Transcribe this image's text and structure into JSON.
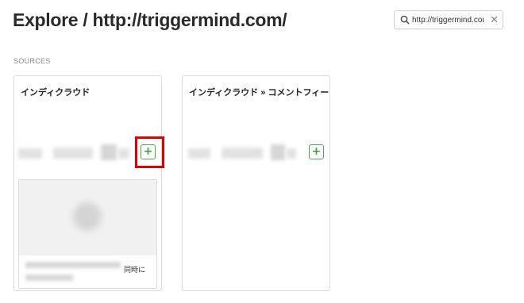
{
  "header": {
    "title": "Explore / http://triggermind.com/",
    "search": {
      "value": "http://triggermind.com/",
      "icon": "search-icon",
      "clear_symbol": "✕"
    }
  },
  "sources": {
    "label": "SOURCES",
    "cards": [
      {
        "title": "インディクラウド",
        "add_symbol": "+",
        "highlighted": true,
        "preview_caption": "同時に"
      },
      {
        "title": "インディクラウド » コメントフィー…",
        "add_symbol": "+",
        "highlighted": false
      }
    ]
  },
  "colors": {
    "accent_green": "#4aaa4f",
    "highlight_red": "#e00000"
  }
}
